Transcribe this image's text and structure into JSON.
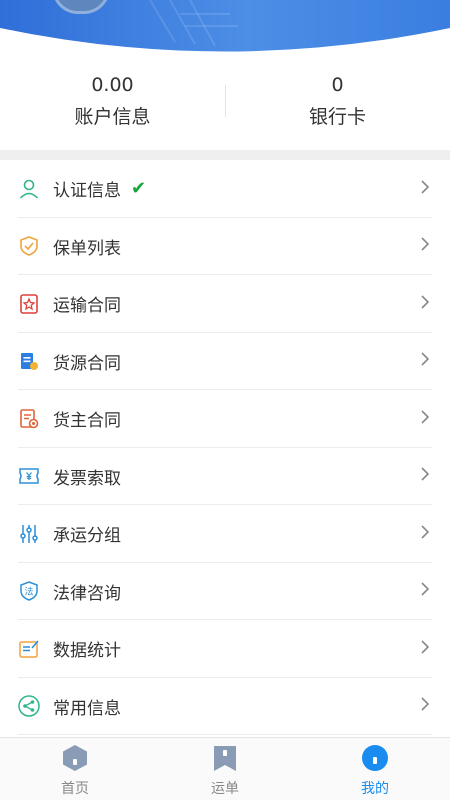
{
  "stats": [
    {
      "value": "0.00",
      "label": "账户信息"
    },
    {
      "value": "0",
      "label": "银行卡"
    }
  ],
  "menu": [
    {
      "label": "认证信息",
      "icon": "user-icon",
      "verified": true,
      "check": "✔"
    },
    {
      "label": "保单列表",
      "icon": "shield-check-icon"
    },
    {
      "label": "运输合同",
      "icon": "star-contract-icon"
    },
    {
      "label": "货源合同",
      "icon": "cargo-contract-icon"
    },
    {
      "label": "货主合同",
      "icon": "owner-contract-icon"
    },
    {
      "label": "发票索取",
      "icon": "invoice-icon"
    },
    {
      "label": "承运分组",
      "icon": "sliders-icon"
    },
    {
      "label": "法律咨询",
      "icon": "law-icon"
    },
    {
      "label": "数据统计",
      "icon": "stats-icon"
    },
    {
      "label": "常用信息",
      "icon": "share-icon"
    }
  ],
  "tabs": [
    {
      "label": "首页",
      "icon": "home-hexagon-icon",
      "active": false
    },
    {
      "label": "运单",
      "icon": "bookmark-icon",
      "active": false
    },
    {
      "label": "我的",
      "icon": "profile-circle-icon",
      "active": true
    }
  ],
  "colors": {
    "header_blue": "#3d7fe0",
    "accent": "#1a8cf0",
    "check_green": "#18a53a",
    "tab_inactive": "#888888"
  }
}
